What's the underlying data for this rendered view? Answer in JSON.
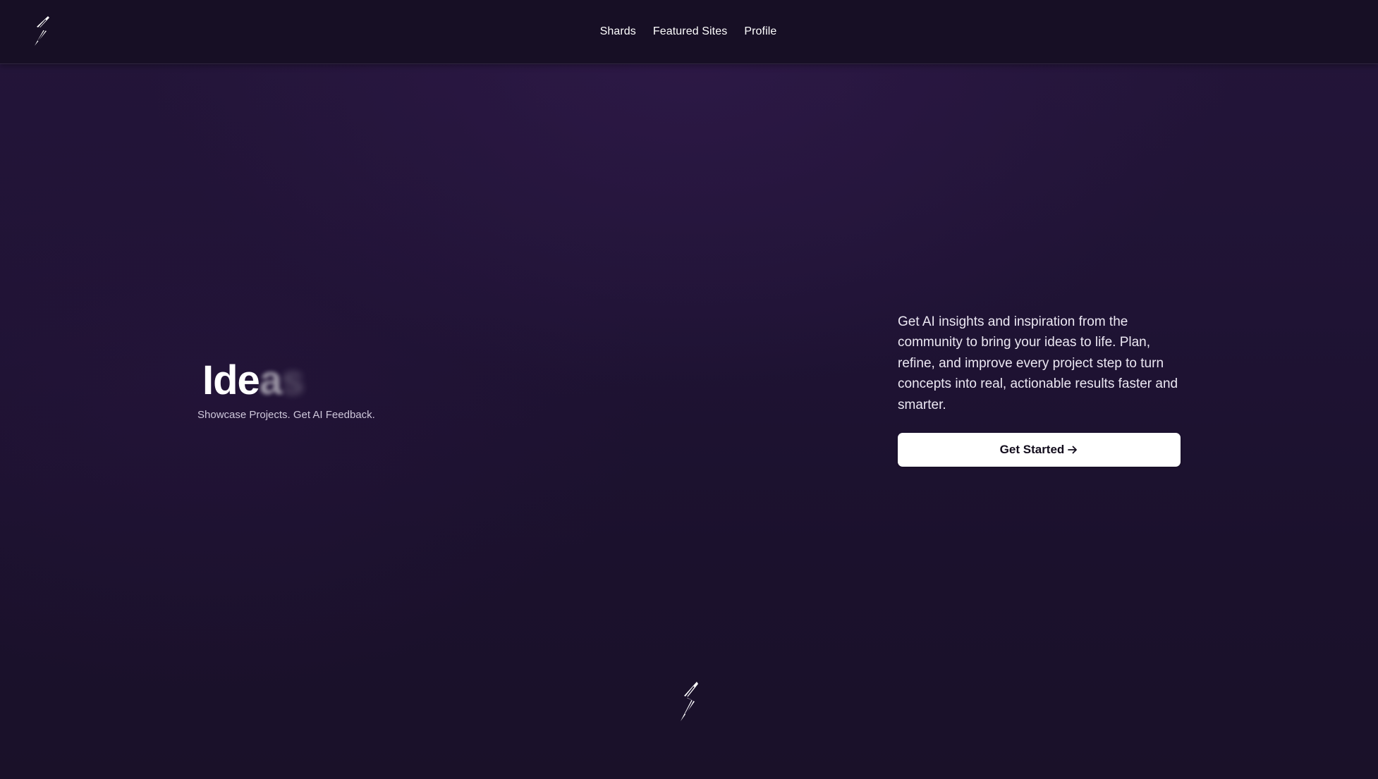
{
  "header": {
    "logo_icon": "lightning-s-logo-icon",
    "nav": [
      {
        "label": "Shards"
      },
      {
        "label": "Featured Sites"
      },
      {
        "label": "Profile"
      }
    ]
  },
  "hero": {
    "word_solid": "Ide",
    "word_fade1": "a",
    "word_fade2": "s",
    "tagline": "Showcase Projects. Get AI Feedback.",
    "description": "Get AI insights and inspiration from the community to bring your ideas to life. Plan, refine, and improve every project step to turn concepts into real, actionable results faster and smarter.",
    "cta_label": "Get Started",
    "cta_icon": "arrow-right-icon"
  },
  "footer": {
    "logo_icon": "lightning-s-logo-icon"
  },
  "colors": {
    "background": "#1d1230",
    "header_bg": "#170f25",
    "cta_bg": "#ffffff",
    "cta_text": "#120c1c"
  }
}
